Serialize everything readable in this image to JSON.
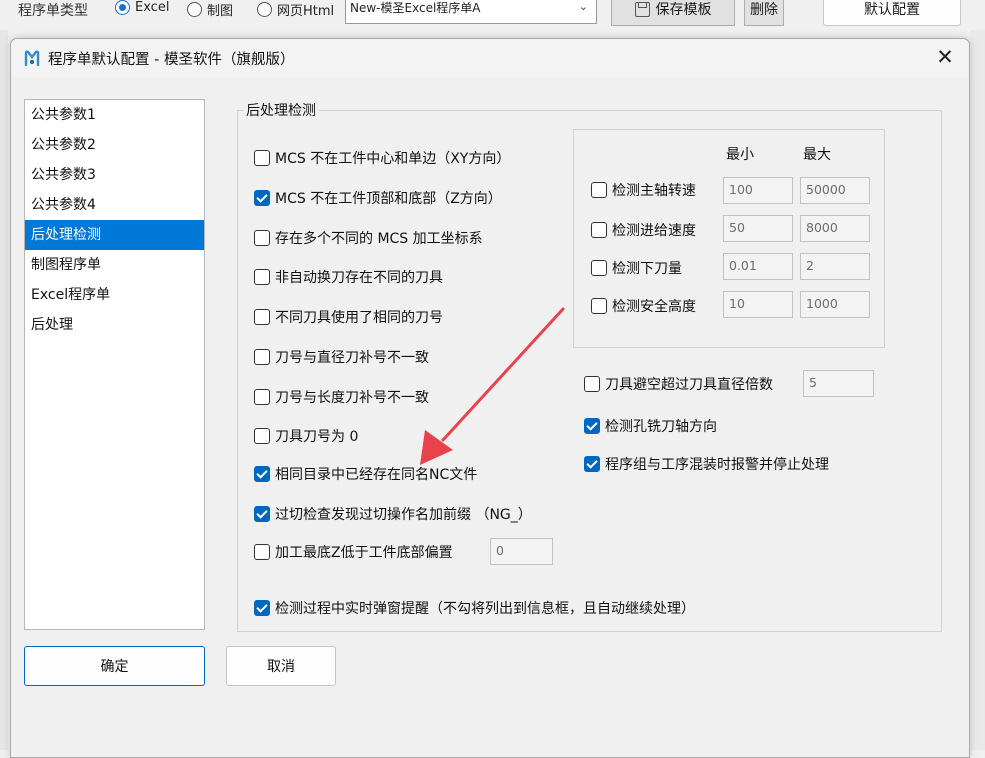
{
  "app_toolbar": {
    "program_type_label": "程序单类型",
    "radio_options": [
      {
        "label": "Excel",
        "selected": true
      },
      {
        "label": "制图",
        "selected": false
      },
      {
        "label": "网页Html",
        "selected": false
      }
    ],
    "template_select_value": "New-模圣Excel程序单A",
    "save_template_label": "保存模板",
    "delete_label": "删除",
    "default_config_label": "默认配置"
  },
  "dialog": {
    "title": "程序单默认配置 - 模圣软件（旗舰版）",
    "nav_items": [
      "公共参数1",
      "公共参数2",
      "公共参数3",
      "公共参数4",
      "后处理检测",
      "制图程序单",
      "Excel程序单",
      "后处理"
    ],
    "active_nav": "后处理检测",
    "group_title": "后处理检测",
    "left_checks": [
      {
        "label": "MCS 不在工件中心和单边（XY方向）",
        "checked": false
      },
      {
        "label": "MCS 不在工件顶部和底部（Z方向）",
        "checked": true
      },
      {
        "label": "存在多个不同的 MCS 加工坐标系",
        "checked": false
      },
      {
        "label": "非自动换刀存在不同的刀具",
        "checked": false
      },
      {
        "label": "不同刀具使用了相同的刀号",
        "checked": false
      },
      {
        "label": "刀号与直径刀补号不一致",
        "checked": false
      },
      {
        "label": "刀号与长度刀补号不一致",
        "checked": false
      },
      {
        "label": "刀具刀号为 0",
        "checked": false
      },
      {
        "label": "相同目录中已经存在同名NC文件",
        "checked": true
      },
      {
        "label": "过切检查发现过切操作名加前缀 （NG_）",
        "checked": true
      },
      {
        "label": "加工最底Z低于工件底部偏置",
        "checked": false
      }
    ],
    "z_offset_value": "0",
    "range_headers": {
      "min": "最小",
      "max": "最大"
    },
    "range_checks": [
      {
        "label": "检测主轴转速",
        "checked": false,
        "min": "100",
        "max": "50000"
      },
      {
        "label": "检测进给速度",
        "checked": false,
        "min": "50",
        "max": "8000"
      },
      {
        "label": "检测下刀量",
        "checked": false,
        "min": "0.01",
        "max": "2"
      },
      {
        "label": "检测安全高度",
        "checked": false,
        "min": "10",
        "max": "1000"
      }
    ],
    "right_checks": [
      {
        "label": "刀具避空超过刀具直径倍数",
        "checked": false
      },
      {
        "label": "检测孔铣刀轴方向",
        "checked": true
      },
      {
        "label": "程序组与工序混装时报警并停止处理",
        "checked": true
      }
    ],
    "tool_clearance_value": "5",
    "popup_check": {
      "label": "检测过程中实时弹窗提醒（不勾将列出到信息框，且自动继续处理）",
      "checked": true
    },
    "ok_label": "确定",
    "cancel_label": "取消"
  },
  "colors": {
    "accent": "#0078d7",
    "checkbox_checked": "#0067c0",
    "annotation_arrow": "#e8434c"
  },
  "icons": {
    "close": "close-icon",
    "logo": "app-logo-icon",
    "save": "save-icon",
    "dropdown": "chevron-down-icon"
  }
}
